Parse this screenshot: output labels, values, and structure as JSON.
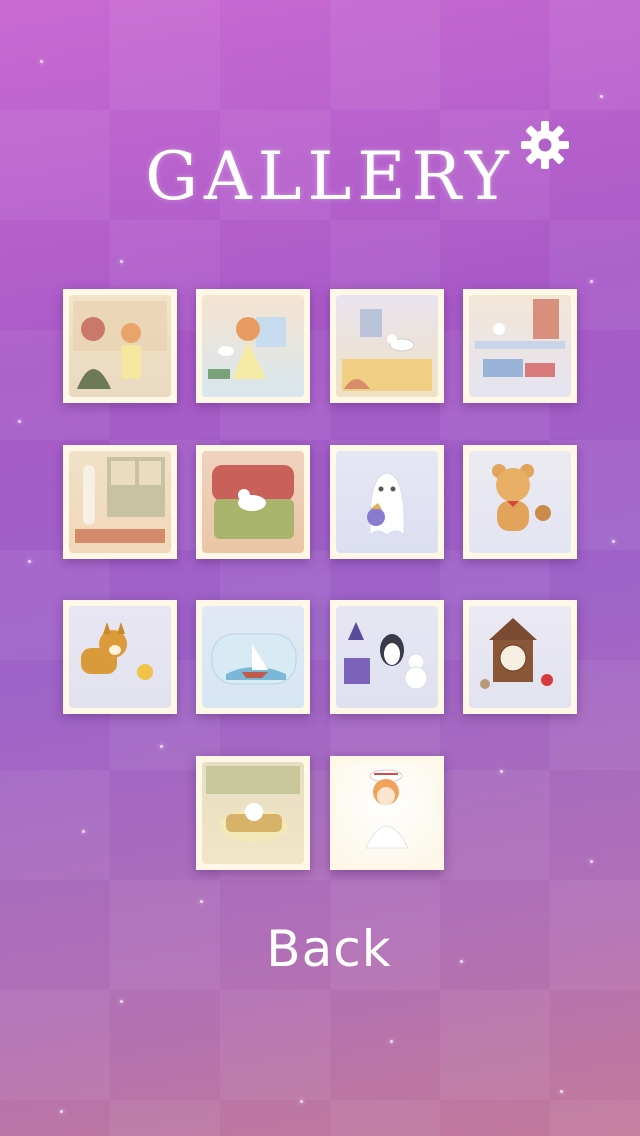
{
  "header": {
    "title": "GALLERY"
  },
  "settings": {
    "icon": "gear-icon"
  },
  "gallery": {
    "items": [
      {
        "id": 1,
        "subject": "girl-and-mother-scene"
      },
      {
        "id": 2,
        "subject": "girl-with-duster-scene"
      },
      {
        "id": 3,
        "subject": "white-cat-on-wall-scene"
      },
      {
        "id": 4,
        "subject": "room-with-cats-scene"
      },
      {
        "id": 5,
        "subject": "cat-at-window-scene"
      },
      {
        "id": 6,
        "subject": "cat-on-armchair-scene"
      },
      {
        "id": 7,
        "subject": "ghost-cat-with-bell-scene"
      },
      {
        "id": 8,
        "subject": "teddy-bear-scene"
      },
      {
        "id": 9,
        "subject": "shiba-dog-scene"
      },
      {
        "id": 10,
        "subject": "ship-in-bottle-scene"
      },
      {
        "id": 11,
        "subject": "penguin-and-snowman-scene"
      },
      {
        "id": 12,
        "subject": "cuckoo-clock-scene"
      },
      {
        "id": 13,
        "subject": "cat-in-bed-scene"
      },
      {
        "id": 14,
        "subject": "girl-in-white-scene"
      }
    ]
  },
  "footer": {
    "back_label": "Back"
  },
  "colors": {
    "accent": "#ffffff",
    "tile_frame": "#fff8e6"
  }
}
